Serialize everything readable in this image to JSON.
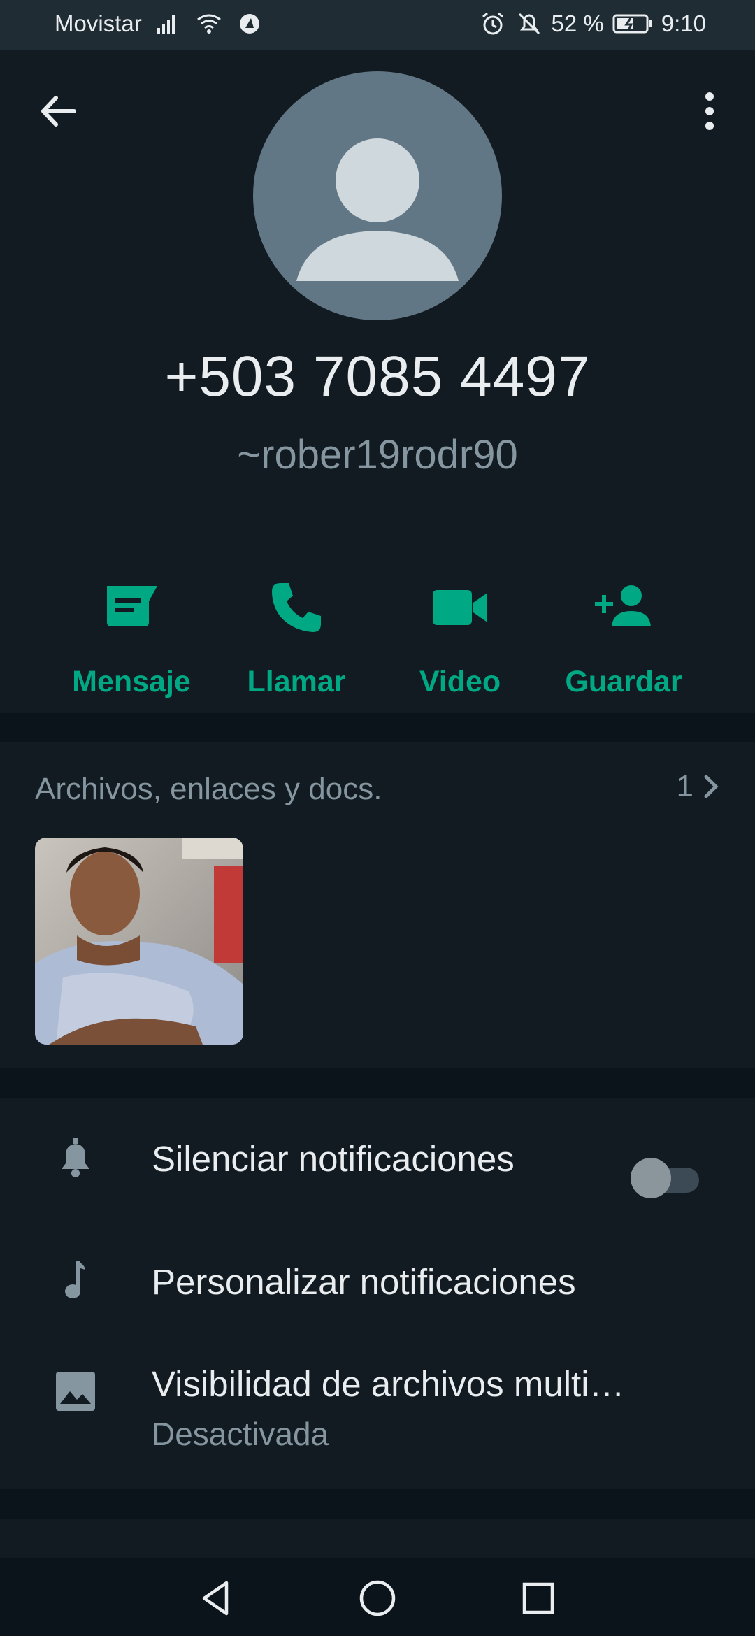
{
  "status_bar": {
    "carrier": "Movistar",
    "battery": "52 %",
    "time": "9:10"
  },
  "contact": {
    "phone": "+503 7085 4497",
    "username": "~rober19rodr90"
  },
  "actions": [
    {
      "label": "Mensaje",
      "icon": "message-icon"
    },
    {
      "label": "Llamar",
      "icon": "phone-icon"
    },
    {
      "label": "Video",
      "icon": "video-icon"
    },
    {
      "label": "Guardar",
      "icon": "add-contact-icon"
    }
  ],
  "media": {
    "title": "Archivos, enlaces y docs.",
    "count": "1"
  },
  "settings": [
    {
      "label": "Silenciar notificaciones",
      "icon": "bell-icon",
      "toggle": false
    },
    {
      "label": "Personalizar notificaciones",
      "icon": "music-note-icon"
    },
    {
      "label": "Visibilidad de archivos multi…",
      "sub": "Desactivada",
      "icon": "image-icon"
    }
  ],
  "colors": {
    "accent": "#00a884",
    "background": "#111b21",
    "divider": "#0b141a",
    "secondary_text": "#8696a0"
  }
}
